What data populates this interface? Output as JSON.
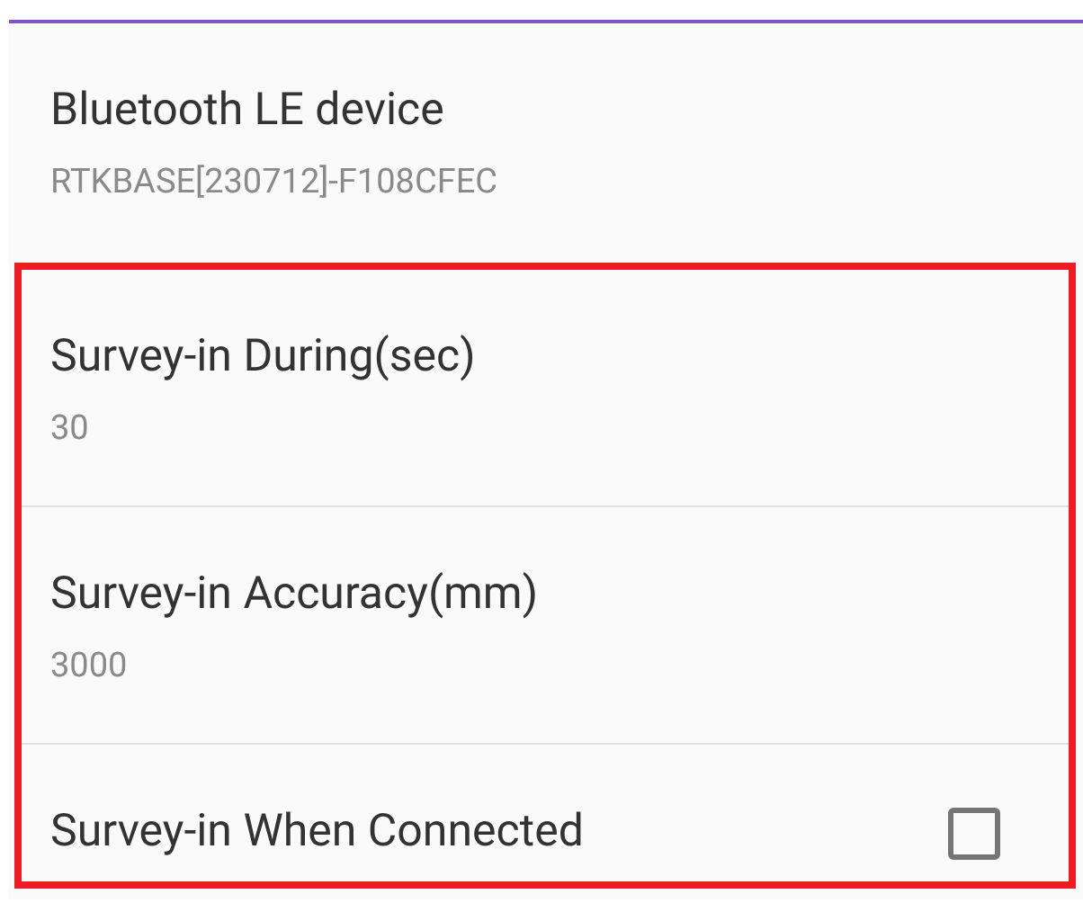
{
  "sections": [
    {
      "highlighted": false,
      "items": [
        {
          "kind": "text",
          "title": "Bluetooth LE device",
          "summary": "RTKBASE[230712]-F108CFEC"
        }
      ]
    },
    {
      "highlighted": true,
      "items": [
        {
          "kind": "text",
          "title": "Survey-in During(sec)",
          "summary": "30"
        },
        {
          "kind": "text",
          "title": "Survey-in Accuracy(mm)",
          "summary": "3000"
        },
        {
          "kind": "checkbox",
          "title": "Survey-in When Connected",
          "checked": false
        }
      ]
    }
  ]
}
